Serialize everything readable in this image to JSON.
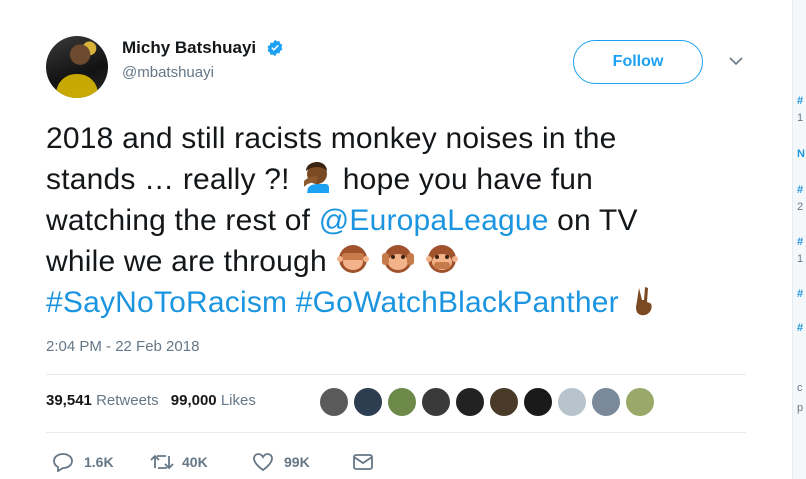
{
  "user": {
    "display_name": "Michy Batshuayi",
    "handle": "@mbatshuayi",
    "verified": true
  },
  "follow_label": "Follow",
  "tweet": {
    "line1": "2018 and still racists monkey noises in the",
    "line2_a": "stands … really ?!",
    "line2_b": "hope you have fun",
    "line3_a": "watching the rest of",
    "line3_mention": "@EuropaLeague",
    "line3_b": "on TV",
    "line4": "while we are through",
    "hashtag1": "#SayNoToRacism",
    "hashtag2": "#GoWatchBlackPanther"
  },
  "timestamp": "2:04 PM - 22 Feb 2018",
  "stats": {
    "retweets_count": "39,541",
    "retweets_label": "Retweets",
    "likes_count": "99,000",
    "likes_label": "Likes"
  },
  "actions": {
    "reply_count": "1.6K",
    "retweet_count": "40K",
    "like_count": "99K"
  },
  "sidebar_fragments": [
    "#",
    "1",
    "N",
    "#",
    "2",
    "#",
    "1",
    "#",
    "#",
    "c",
    "p"
  ],
  "colors": {
    "accent": "#1da1f2",
    "link": "#1b95e0",
    "muted": "#657786"
  }
}
